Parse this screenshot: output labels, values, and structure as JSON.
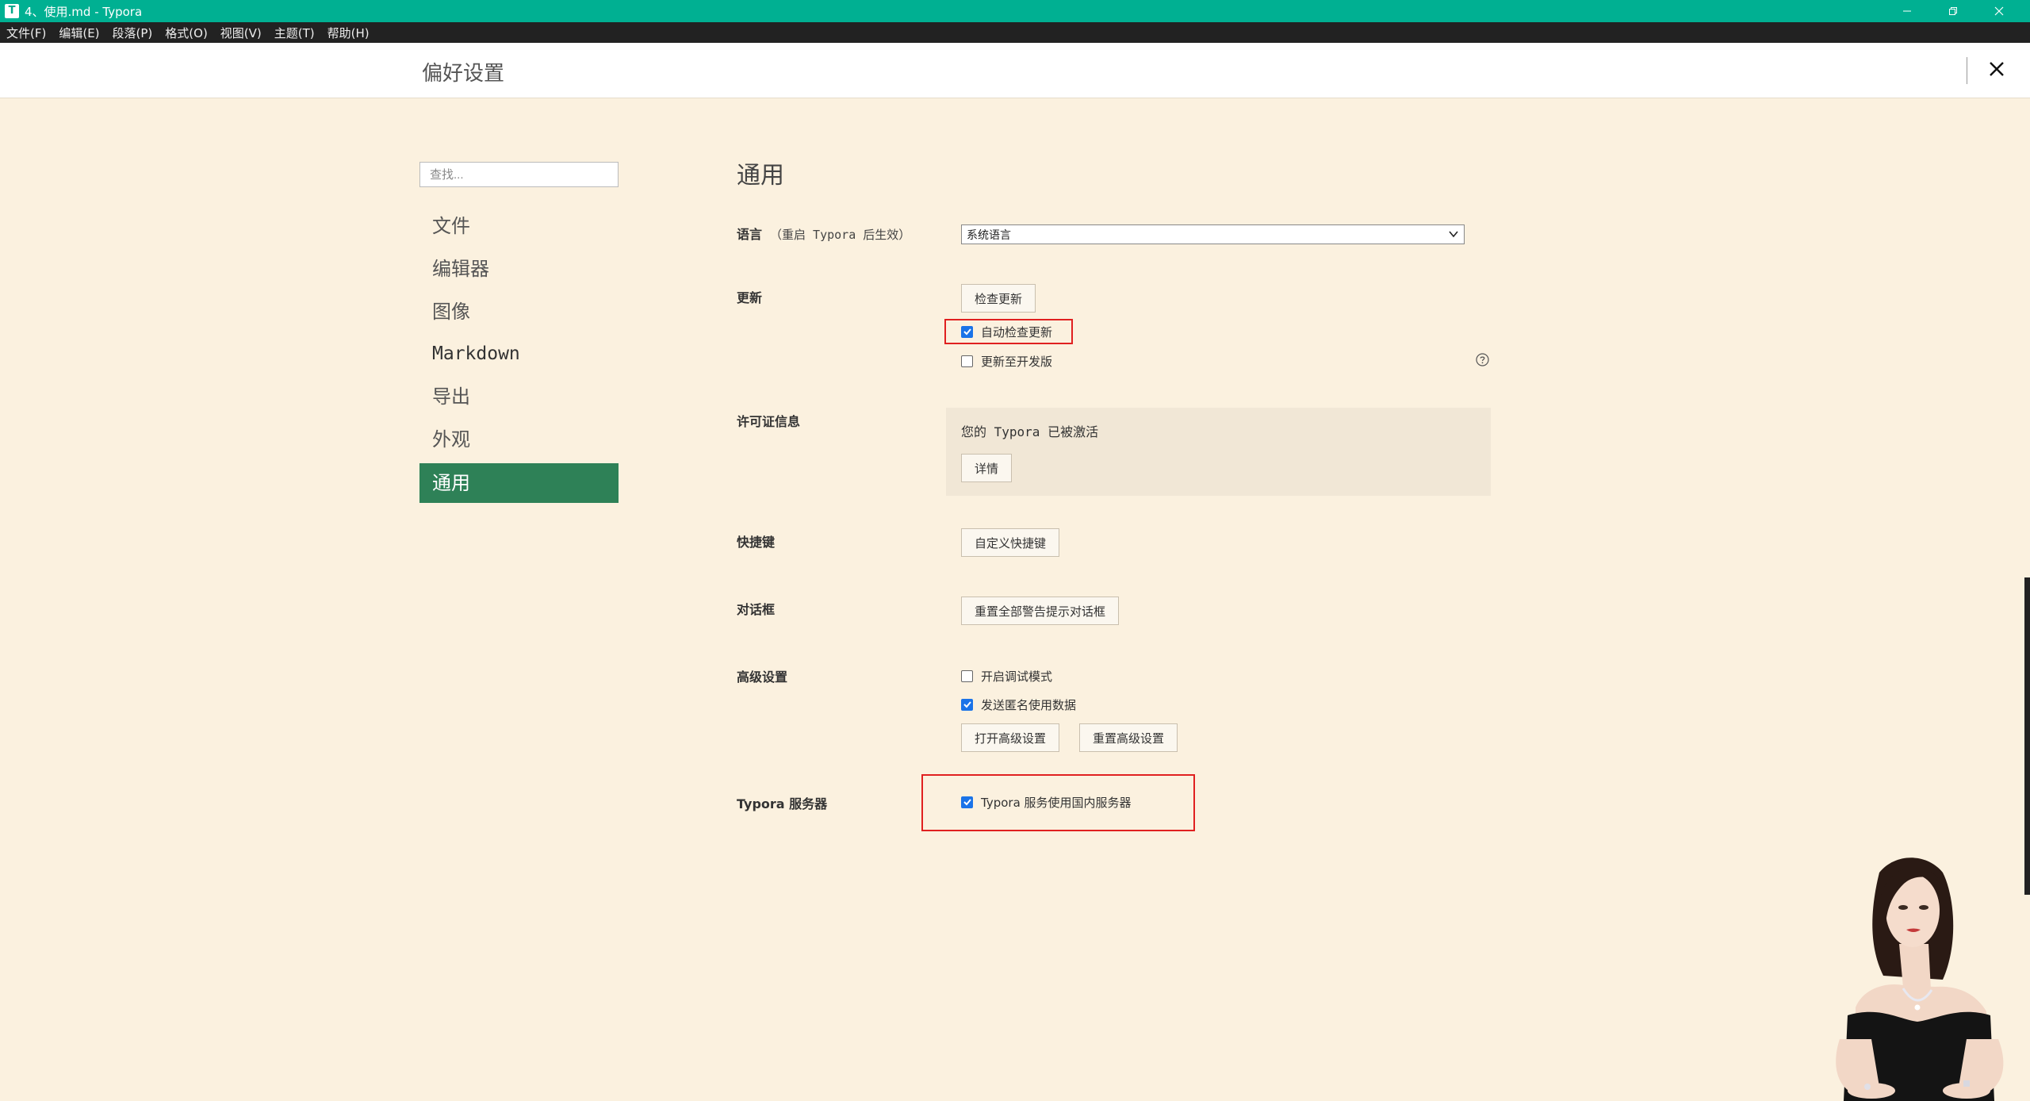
{
  "window": {
    "title": "4、使用.md - Typora",
    "icon_letter": "T",
    "controls": [
      "minimize-icon",
      "restore-icon",
      "close-icon"
    ]
  },
  "menu": [
    "文件(F)",
    "编辑(E)",
    "段落(P)",
    "格式(O)",
    "视图(V)",
    "主题(T)",
    "帮助(H)"
  ],
  "header": {
    "title": "偏好设置"
  },
  "sidebar": {
    "search_placeholder": "查找...",
    "items": [
      {
        "label": "文件"
      },
      {
        "label": "编辑器"
      },
      {
        "label": "图像"
      },
      {
        "label": "Markdown"
      },
      {
        "label": "导出"
      },
      {
        "label": "外观"
      },
      {
        "label": "通用",
        "active": true
      }
    ]
  },
  "main": {
    "section_title": "通用",
    "language": {
      "label": "语言",
      "note": "（重启 Typora 后生效）",
      "selected": "系统语言"
    },
    "update": {
      "label": "更新",
      "check_button": "检查更新",
      "auto_check": {
        "label": "自动检查更新",
        "checked": true
      },
      "dev_channel": {
        "label": "更新至开发版",
        "checked": false
      }
    },
    "license": {
      "label": "许可证信息",
      "status": "您的 Typora 已被激活",
      "details_button": "详情"
    },
    "shortcuts": {
      "label": "快捷键",
      "button": "自定义快捷键"
    },
    "dialogs": {
      "label": "对话框",
      "button": "重置全部警告提示对话框"
    },
    "advanced": {
      "label": "高级设置",
      "debug_mode": {
        "label": "开启调试模式",
        "checked": false
      },
      "anonymous_data": {
        "label": "发送匿名使用数据",
        "checked": true
      },
      "open_button": "打开高级设置",
      "reset_button": "重置高级设置"
    },
    "server": {
      "label": "Typora 服务器",
      "domestic": {
        "label": "Typora 服务使用国内服务器",
        "checked": true
      }
    }
  },
  "colors": {
    "titlebar": "#00b092",
    "menubar": "#222222",
    "background": "#fbf1df",
    "active_nav": "#2e8157",
    "highlight_box": "#e02020",
    "checkbox": "#1a73e8"
  }
}
